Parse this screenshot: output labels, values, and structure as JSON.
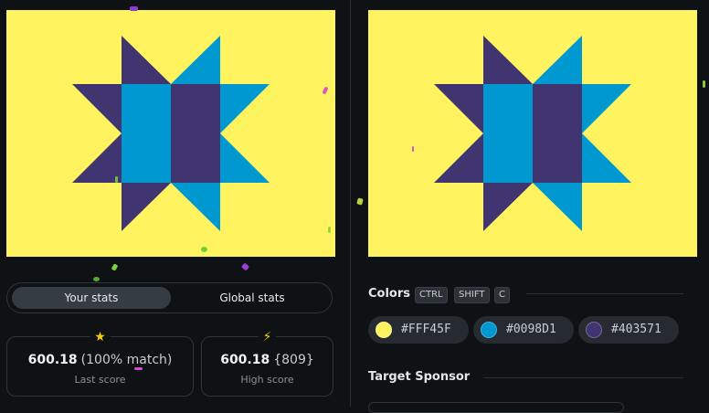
{
  "palette": {
    "yellow": "#FFF45F",
    "blue": "#0098D1",
    "purple": "#403571",
    "background": "#0f1215"
  },
  "stats": {
    "tabs": {
      "your_stats": "Your stats",
      "global_stats": "Global stats"
    },
    "last": {
      "score": "600.18",
      "detail": "(100% match)",
      "label": "Last score",
      "icon": "star-icon"
    },
    "high": {
      "score": "600.18",
      "detail": "{809}",
      "label": "High score",
      "icon": "lightning-icon"
    }
  },
  "colors": {
    "title": "Colors",
    "shortcut_keys": [
      "CTRL",
      "SHIFT",
      "C"
    ],
    "swatches": [
      {
        "hex": "#FFF45F"
      },
      {
        "hex": "#0098D1"
      },
      {
        "hex": "#403571"
      }
    ]
  },
  "sponsor": {
    "title": "Target Sponsor"
  }
}
